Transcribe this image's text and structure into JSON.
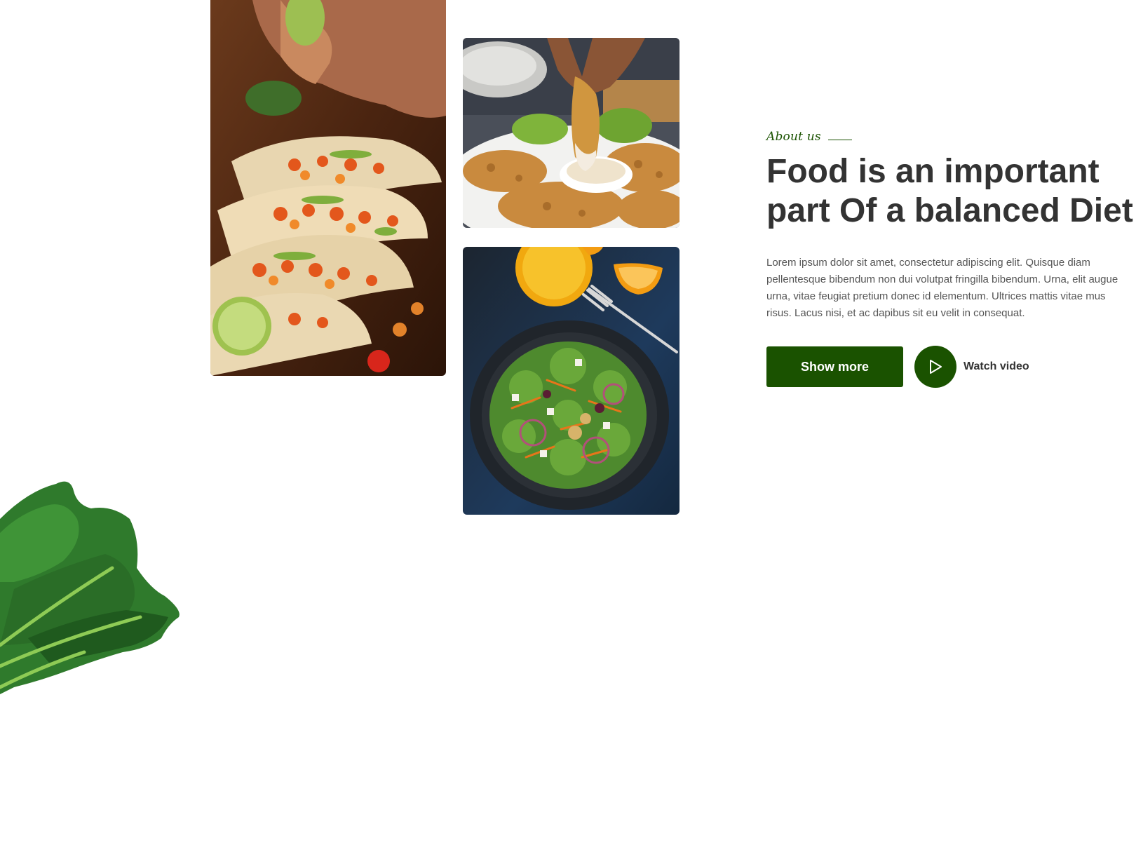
{
  "about": {
    "eyebrow": "About us",
    "headline_line1": "Food is an important",
    "headline_line2": "part Of a balanced Diet",
    "body": "Lorem ipsum dolor sit amet, consectetur adipiscing elit. Quisque diam pellentesque bibendum non dui volutpat fringilla bibendum. Urna, elit augue urna, vitae feugiat pretium donec id elementum. Ultrices mattis vitae mus risus. Lacus nisi, et ac dapibus sit eu velit in consequat.",
    "show_more_label": "Show more",
    "watch_video_label": "Watch video"
  },
  "colors": {
    "brand_green": "#1a5200",
    "heading": "#333333",
    "body_text": "#555555"
  },
  "icons": {
    "play": "play-icon"
  }
}
